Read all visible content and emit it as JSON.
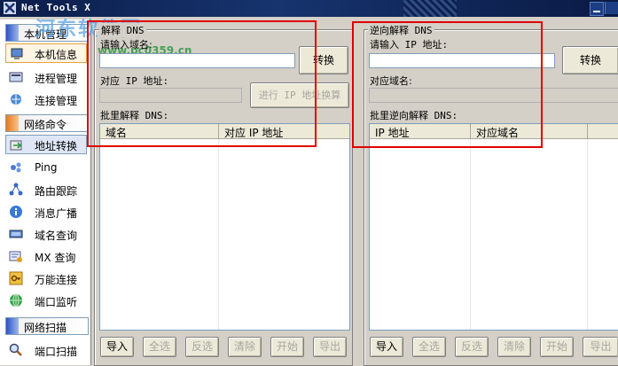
{
  "window": {
    "title": "Net Tools X"
  },
  "watermark": {
    "text1": "河东软件园",
    "text2": "www.pc0359.cn"
  },
  "sidebar": {
    "groups": [
      {
        "label": "本机管理"
      },
      {
        "label": "网络命令"
      },
      {
        "label": "网络扫描"
      }
    ],
    "items": [
      {
        "label": "本机信息",
        "icon": "computer-icon"
      },
      {
        "label": "进程管理",
        "icon": "process-icon"
      },
      {
        "label": "连接管理",
        "icon": "connection-icon"
      },
      {
        "label": "地址转换",
        "icon": "address-convert-icon"
      },
      {
        "label": "Ping",
        "icon": "ping-icon"
      },
      {
        "label": "路由跟踪",
        "icon": "route-trace-icon"
      },
      {
        "label": "消息广播",
        "icon": "info-icon"
      },
      {
        "label": "域名查询",
        "icon": "keyboard-icon"
      },
      {
        "label": "MX 查询",
        "icon": "mx-query-icon"
      },
      {
        "label": "万能连接",
        "icon": "key-icon"
      },
      {
        "label": "端口监听",
        "icon": "globe-icon"
      },
      {
        "label": "端口扫描",
        "icon": "magnifier-icon"
      }
    ]
  },
  "dns": {
    "legend": "解释 DNS",
    "domain_label": "请输入域名:",
    "convert_button": "转换",
    "ip_label": "对应 IP 地址:",
    "ip_calc_button": "进行 IP 地址换算",
    "batch_label": "批里解释 DNS:",
    "columns": [
      "域名",
      "对应 IP 地址"
    ],
    "buttons": [
      "导入",
      "全选",
      "反选",
      "清除",
      "开始",
      "导出"
    ]
  },
  "rdns": {
    "legend": "逆向解释 DNS",
    "ip_label": "请输入 IP 地址:",
    "convert_button": "转换",
    "domain_label": "对应域名:",
    "batch_label": "批里逆向解释 DNS:",
    "columns": [
      "IP 地址",
      "对应域名"
    ],
    "buttons": [
      "导入",
      "全选",
      "反选",
      "清除",
      "开始",
      "导出"
    ]
  }
}
